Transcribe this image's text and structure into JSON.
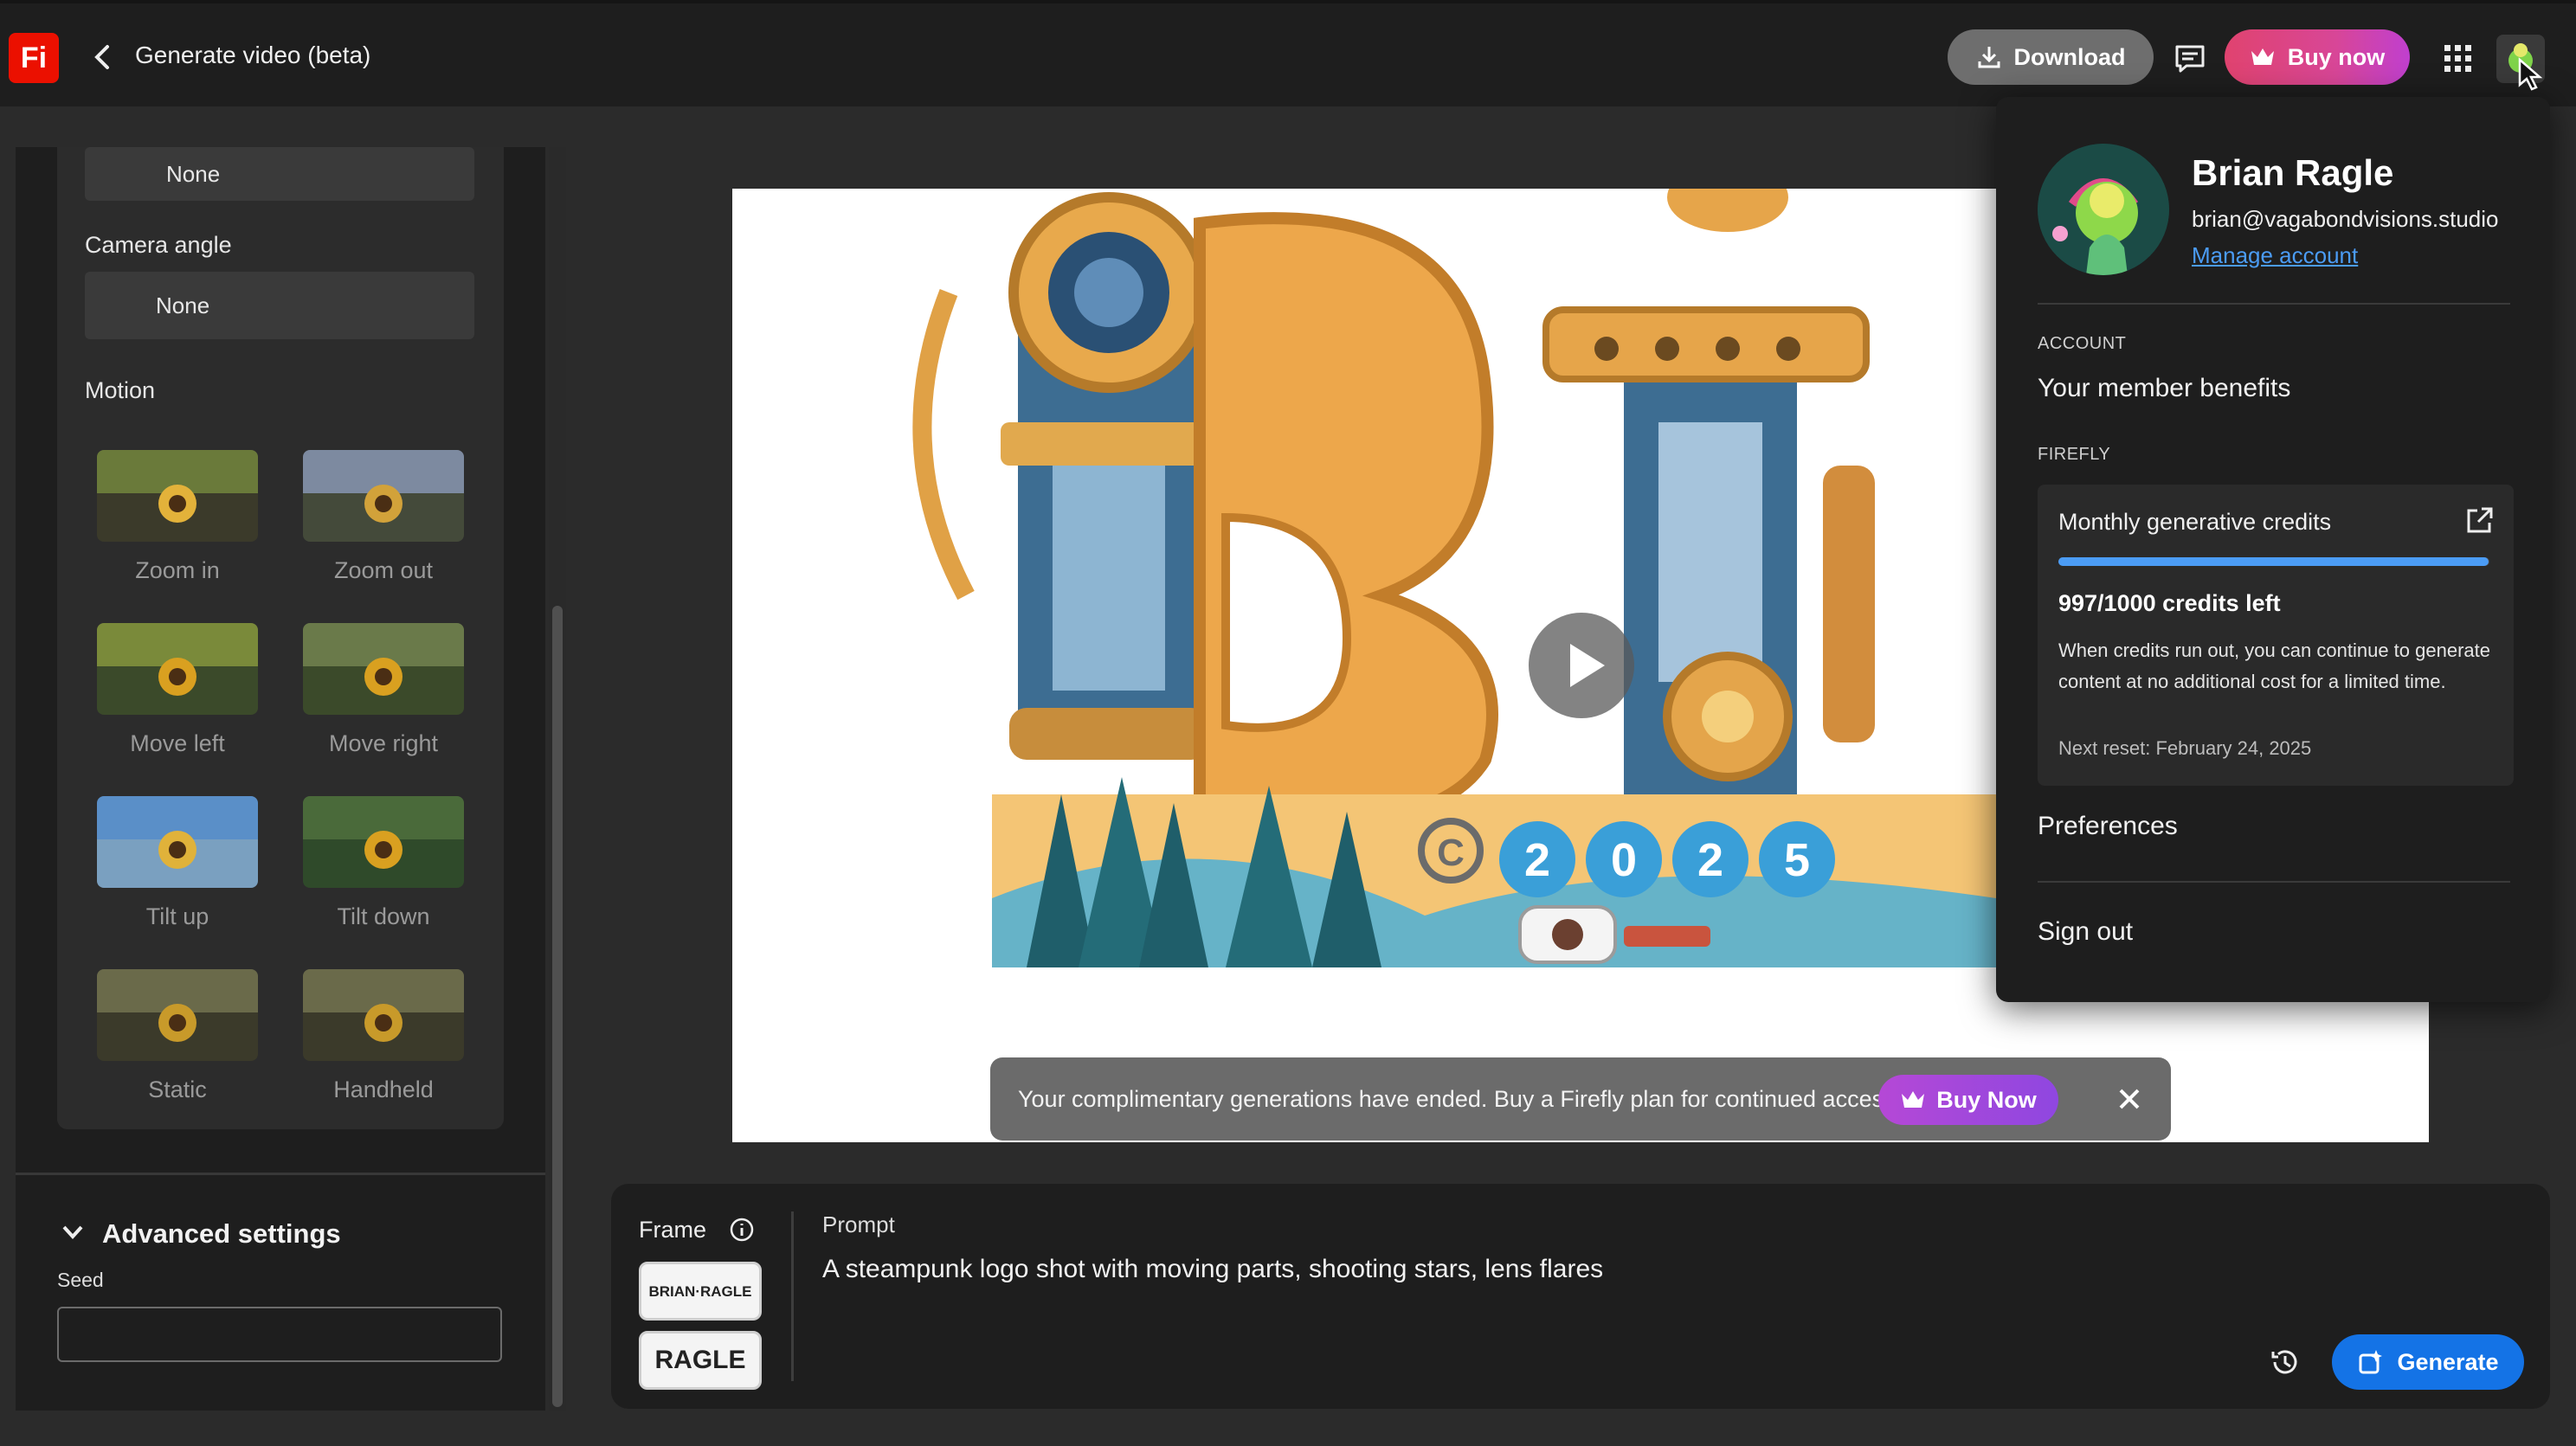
{
  "header": {
    "logo_text": "Fi",
    "title": "Generate video (beta)",
    "download_label": "Download",
    "buy_now_label": "Buy now"
  },
  "left_panel": {
    "top_select_value": "None",
    "camera_angle_label": "Camera angle",
    "camera_angle_value": "None",
    "motion_label": "Motion",
    "motion_options": [
      {
        "label": "Zoom in"
      },
      {
        "label": "Zoom out"
      },
      {
        "label": "Move left"
      },
      {
        "label": "Move right"
      },
      {
        "label": "Tilt up"
      },
      {
        "label": "Tilt down"
      },
      {
        "label": "Static"
      },
      {
        "label": "Handheld"
      }
    ],
    "advanced_settings_label": "Advanced settings",
    "seed_label": "Seed",
    "seed_value": ""
  },
  "canvas": {
    "art_year": [
      "2",
      "0",
      "2",
      "5"
    ],
    "toast_text": "Your complimentary generations have ended. Buy a Firefly plan for continued access.",
    "toast_buy_label": "Buy Now"
  },
  "prompt": {
    "frame_label": "Frame",
    "frame_thumb_1": "BRIAN·RAGLE",
    "frame_thumb_2": "RAGLE",
    "prompt_label": "Prompt",
    "prompt_text": "A steampunk logo shot with moving parts, shooting stars, lens flares",
    "generate_label": "Generate"
  },
  "account": {
    "name": "Brian Ragle",
    "email": "brian@vagabondvisions.studio",
    "manage_label": "Manage account",
    "account_section": "ACCOUNT",
    "member_benefits": "Your member benefits",
    "firefly_section": "FIREFLY",
    "credits_title": "Monthly generative credits",
    "credits_used_fraction": 0.997,
    "credits_left": "997/1000 credits left",
    "credits_desc": "When credits run out, you can continue to generate content at no additional cost for a limited time.",
    "credits_reset": "Next reset: February 24, 2025",
    "preferences": "Preferences",
    "sign_out": "Sign out"
  },
  "colors": {
    "brand_red": "#eb1000",
    "accent_blue": "#1473e6",
    "link_blue": "#4b9cf5"
  }
}
